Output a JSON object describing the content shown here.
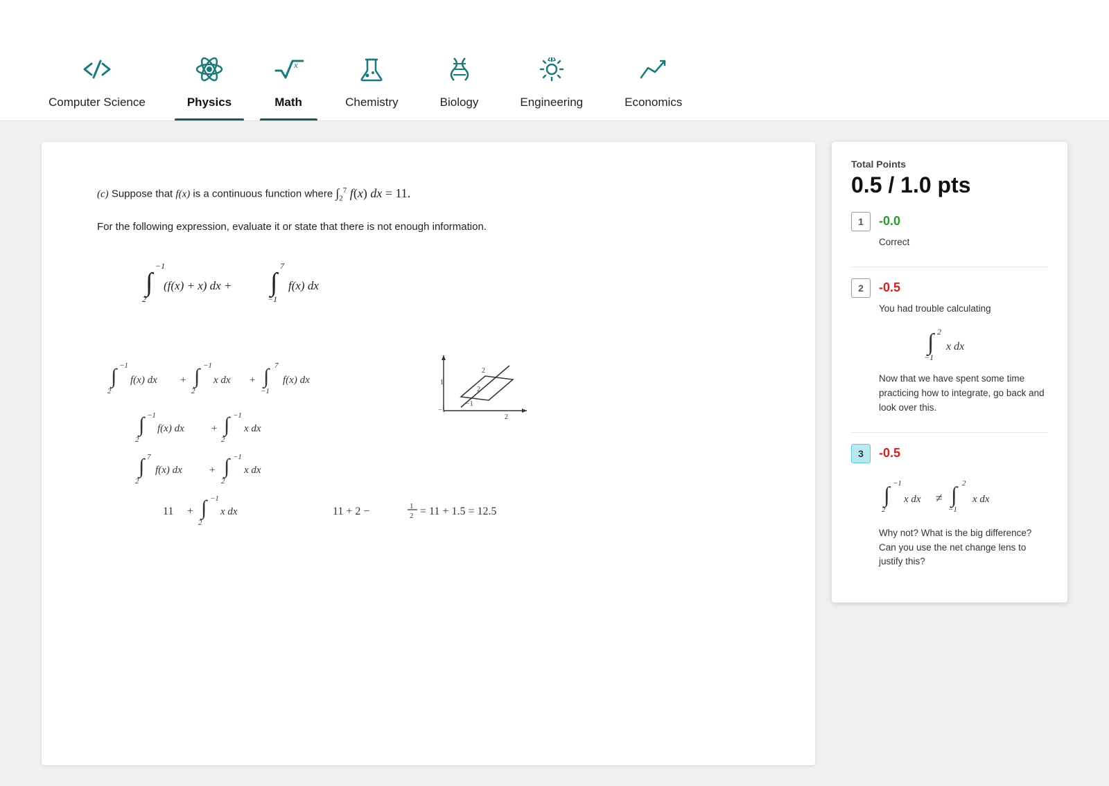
{
  "nav": {
    "items": [
      {
        "id": "cs",
        "label": "Computer Science",
        "icon": "code",
        "active": false
      },
      {
        "id": "physics",
        "label": "Physics",
        "icon": "atom",
        "active": true
      },
      {
        "id": "math",
        "label": "Math",
        "icon": "sqrt",
        "active": true
      },
      {
        "id": "chemistry",
        "label": "Chemistry",
        "icon": "flask",
        "active": false
      },
      {
        "id": "biology",
        "label": "Biology",
        "icon": "dna",
        "active": false
      },
      {
        "id": "engineering",
        "label": "Engineering",
        "icon": "gear",
        "active": false
      },
      {
        "id": "economics",
        "label": "Economics",
        "icon": "chart",
        "active": false
      }
    ]
  },
  "problem": {
    "label": "(c)",
    "text": "Suppose that f(x) is a continuous function where",
    "integral_text": "∫₂⁷ f(x) dx = 11.",
    "sub_text": "For the following expression, evaluate it or state that there is not enough information."
  },
  "feedback": {
    "total_label": "Total Points",
    "total_value": "0.5 / 1.0 pts",
    "items": [
      {
        "num": "1",
        "score": "-0.0",
        "score_class": "score-green",
        "highlight": false,
        "text": "Correct",
        "math": null,
        "extra": null
      },
      {
        "num": "2",
        "score": "-0.5",
        "score_class": "score-red",
        "highlight": false,
        "text": "You had trouble calculating",
        "math": "∫₋₁² x dx",
        "extra": "Now that we have spent some time practicing how to integrate, go back and look over this."
      },
      {
        "num": "3",
        "score": "-0.5",
        "score_class": "score-red",
        "highlight": true,
        "text": null,
        "math": "∫₂⁻¹ x dx ≠ ∫₋₁² x dx",
        "extra": "Why not? What is the big difference? Can you use the net change lens to justify this?"
      }
    ]
  }
}
